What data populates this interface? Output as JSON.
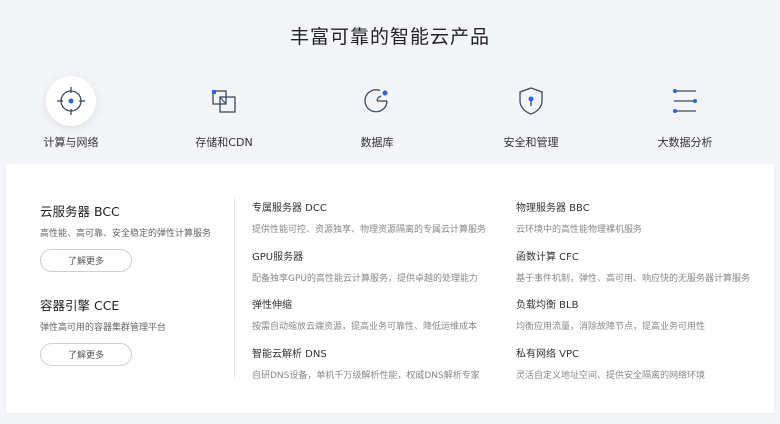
{
  "page_title": "丰富可靠的智能云产品",
  "categories": [
    {
      "label": "计算与网络",
      "icon": "crosshair-icon",
      "active": true
    },
    {
      "label": "存储和CDN",
      "icon": "storage-icon",
      "active": false
    },
    {
      "label": "数据库",
      "icon": "database-chart-icon",
      "active": false
    },
    {
      "label": "安全和管理",
      "icon": "shield-icon",
      "active": false
    },
    {
      "label": "大数据分析",
      "icon": "list-bars-icon",
      "active": false
    }
  ],
  "featured": [
    {
      "title": "云服务器 BCC",
      "desc": "高性能、高可靠、安全稳定的弹性计算服务",
      "button": "了解更多"
    },
    {
      "title": "容器引擎 CCE",
      "desc": "弹性高可用的容器集群管理平台",
      "button": "了解更多"
    }
  ],
  "products": [
    {
      "name": "专属服务器 DCC",
      "desc": "提供性能可控、资源独享、物理资源隔离的专属云计算服务"
    },
    {
      "name": "物理服务器 BBC",
      "desc": "云环境中的高性能物理裸机服务"
    },
    {
      "name": "GPU服务器",
      "desc": "配备独享GPU的高性能云计算服务，提供卓越的处理能力"
    },
    {
      "name": "函数计算 CFC",
      "desc": "基于事件机制，弹性、高可用、响应快的无服务器计算服务"
    },
    {
      "name": "弹性伸缩",
      "desc": "按需自动缩放云端资源，提高业务可靠性、降低运维成本"
    },
    {
      "name": "负载均衡 BLB",
      "desc": "均衡应用流量，消除故障节点，提高业务可用性"
    },
    {
      "name": "智能云解析 DNS",
      "desc": "自研DNS设备，单机千万级解析性能，权威DNS解析专家"
    },
    {
      "name": "私有网络 VPC",
      "desc": "灵活自定义地址空间、提供安全隔离的网络环境"
    }
  ],
  "colors": {
    "accent": "#2468f2",
    "icon_stroke": "#3c4a5c",
    "background": "#f3f5f8"
  }
}
